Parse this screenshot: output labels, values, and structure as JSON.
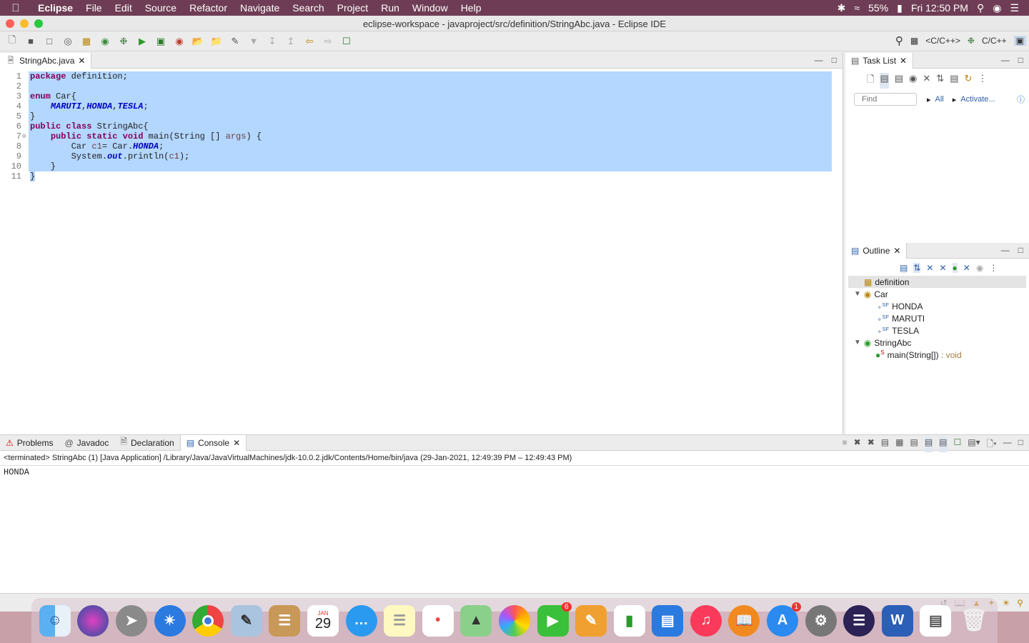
{
  "menubar": {
    "app": "Eclipse",
    "items": [
      "File",
      "Edit",
      "Source",
      "Refactor",
      "Navigate",
      "Search",
      "Project",
      "Run",
      "Window",
      "Help"
    ],
    "battery": "55%",
    "clock": "Fri 12:50 PM"
  },
  "window": {
    "title": "eclipse-workspace - javaproject/src/definition/StringAbc.java - Eclipse IDE"
  },
  "toolbar": {
    "perspective_cpp1": "<C/C++>",
    "perspective_cpp2": "C/C++"
  },
  "editor": {
    "tab_label": "StringAbc.java",
    "lines": [
      {
        "n": "1",
        "text": "package definition;"
      },
      {
        "n": "2",
        "text": ""
      },
      {
        "n": "3",
        "text": "enum Car{"
      },
      {
        "n": "4",
        "text": "    MARUTI,HONDA,TESLA;"
      },
      {
        "n": "5",
        "text": "}"
      },
      {
        "n": "6",
        "text": "public class StringAbc{"
      },
      {
        "n": "7",
        "text": "    public static void main(String [] args) {"
      },
      {
        "n": "8",
        "text": "        Car c1= Car.HONDA;"
      },
      {
        "n": "9",
        "text": "        System.out.println(c1);"
      },
      {
        "n": "10",
        "text": "    }"
      },
      {
        "n": "11",
        "text": "}"
      }
    ]
  },
  "tasklist": {
    "tab_label": "Task List",
    "find_placeholder": "Find",
    "all_label": "All",
    "activate_label": "Activate..."
  },
  "outline": {
    "tab_label": "Outline",
    "items": [
      {
        "label": "definition"
      },
      {
        "label": "Car"
      },
      {
        "label": "HONDA"
      },
      {
        "label": "MARUTI"
      },
      {
        "label": "TESLA"
      },
      {
        "label": "StringAbc"
      },
      {
        "label": "main(String[])",
        "suffix": " : void"
      }
    ]
  },
  "bottom": {
    "tabs": [
      "Problems",
      "Javadoc",
      "Declaration",
      "Console"
    ],
    "console_header": "<terminated> StringAbc (1) [Java Application] /Library/Java/JavaVirtualMachines/jdk-10.0.2.jdk/Contents/Home/bin/java  (29-Jan-2021, 12:49:39 PM – 12:49:43 PM)",
    "output": "HONDA"
  },
  "dock": {
    "calendar_month": "JAN",
    "calendar_day": "29",
    "facetime_badge": "6",
    "appstore_badge": "1"
  }
}
